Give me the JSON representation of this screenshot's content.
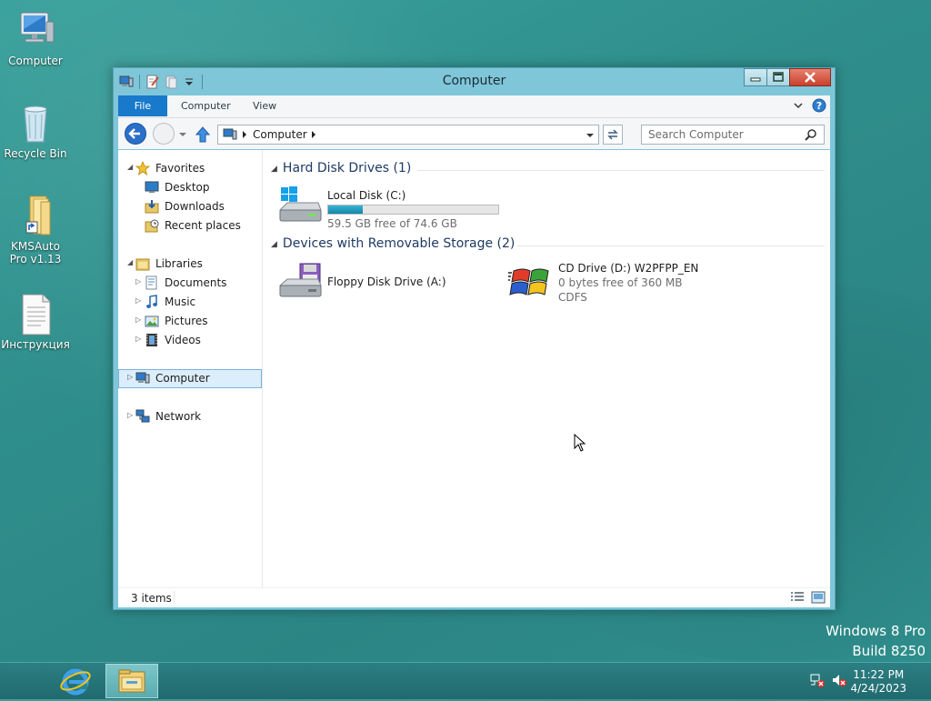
{
  "desktop": {
    "icons": [
      {
        "label": "Computer"
      },
      {
        "label": "Recycle Bin"
      },
      {
        "label": "KMSAuto Pro v1.13"
      },
      {
        "label": "Инструкция"
      }
    ],
    "watermark": {
      "line1": "Windows 8 Pro",
      "line2": "Build 8250"
    }
  },
  "window": {
    "title": "Computer",
    "ribbon_tabs": {
      "file": "File",
      "computer": "Computer",
      "view": "View"
    },
    "address_path": "Computer",
    "search_placeholder": "Search Computer",
    "status": "3 items"
  },
  "nav": {
    "favorites": "Favorites",
    "desktop": "Desktop",
    "downloads": "Downloads",
    "recent": "Recent places",
    "libraries": "Libraries",
    "documents": "Documents",
    "music": "Music",
    "pictures": "Pictures",
    "videos": "Videos",
    "computer": "Computer",
    "network": "Network"
  },
  "groups": {
    "hdd": {
      "title": "Hard Disk Drives (1)",
      "drives": [
        {
          "name": "Local Disk (C:)",
          "free_text": "59.5 GB free of 74.6 GB",
          "used_fraction": 0.203
        }
      ]
    },
    "removable": {
      "title": "Devices with Removable Storage (2)",
      "drives": [
        {
          "name": "Floppy Disk Drive (A:)"
        },
        {
          "name": "CD Drive (D:) W2PFPP_EN",
          "free_text": "0 bytes free of 360 MB",
          "fs": "CDFS"
        }
      ]
    }
  },
  "taskbar": {
    "time": "11:22 PM",
    "date": "4/24/2023"
  },
  "colors": {
    "accent": "#1979ca",
    "selection": "#dceefb",
    "group_header": "#1e3a63"
  }
}
